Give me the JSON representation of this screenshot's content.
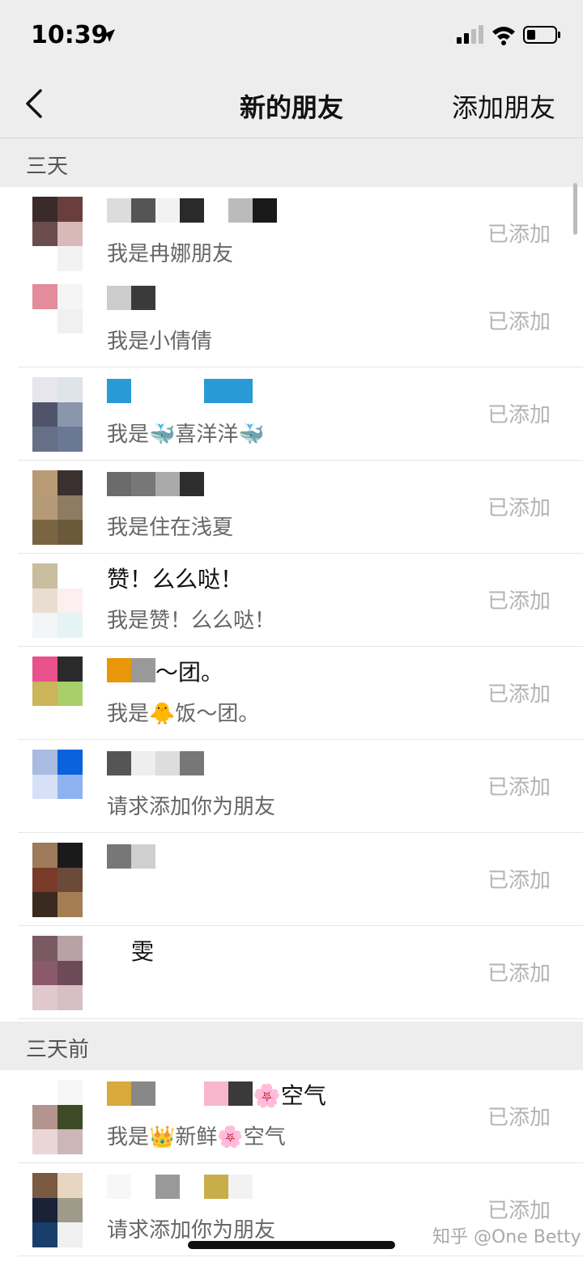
{
  "status_bar": {
    "time": "10:39"
  },
  "nav": {
    "title": "新的朋友",
    "add_friend": "添加朋友"
  },
  "sections": [
    {
      "label": "三天"
    },
    {
      "label": "三天前"
    }
  ],
  "rows": [
    {
      "name": "",
      "message": "我是冉娜朋友",
      "status": "已添加",
      "avatar_colors": [
        "#3a2a2a",
        "#6b3e3e",
        "#6b4d4d",
        "#d9b8b8",
        "#ffffff",
        "#f2f2f2"
      ],
      "name_mosaic": [
        "#dcdcdc",
        "#555555",
        "#f2f2f2",
        "#2a2a2a",
        "#ffffff",
        "#bbbbbb",
        "#1a1a1a"
      ]
    },
    {
      "name": "",
      "message": "我是小倩倩",
      "status": "已添加",
      "avatar_colors": [
        "#e38c9c",
        "#f5f5f5",
        "#ffffff",
        "#f0f0f0",
        "#ffffff",
        "#ffffff"
      ],
      "name_mosaic": [
        "#cccccc",
        "#3a3a3a"
      ]
    },
    {
      "name": "",
      "message": "我是🐳喜洋洋🐳",
      "status": "已添加",
      "avatar_colors": [
        "#e6e6ec",
        "#dfe4ea",
        "#50546a",
        "#8a96ab",
        "#657088",
        "#6b7894"
      ],
      "name_mosaic": [
        "#2a9ad6",
        "#ffffff",
        "#ffffff",
        "#ffffff",
        "#2a9ad6",
        "#2a9ad6"
      ]
    },
    {
      "name": "",
      "message": "我是住在浅夏",
      "status": "已添加",
      "avatar_colors": [
        "#b89a75",
        "#3a3030",
        "#b59a78",
        "#8f7b62",
        "#7a6542",
        "#6b5a3a"
      ],
      "name_mosaic": [
        "#6b6b6b",
        "#777777",
        "#aaaaaa",
        "#2d2d2d"
      ]
    },
    {
      "name": "赞！么么哒！",
      "message": "我是赞！么么哒！",
      "status": "已添加",
      "avatar_colors": [
        "#c9bd9f",
        "#ffffff",
        "#e8ddd0",
        "#fbeff0",
        "#f2f6f7",
        "#e6f3f5"
      ],
      "name_mosaic": []
    },
    {
      "name": "～团。",
      "message": "我是🐥饭～团。",
      "status": "已添加",
      "avatar_colors": [
        "#e9528c",
        "#2a2a2a",
        "#cbb45a",
        "#a8cf6a",
        "#ffffff",
        "#ffffff"
      ],
      "name_mosaic": [
        "#e8960a",
        "#999999"
      ]
    },
    {
      "name": "",
      "message": "请求添加你为朋友",
      "status": "已添加",
      "avatar_colors": [
        "#a9bbe0",
        "#0a62dc",
        "#d6e1f7",
        "#8fb2f0",
        "#ffffff",
        "#ffffff"
      ],
      "name_mosaic": [
        "#555555",
        "#eeeeee",
        "#dddddd",
        "#777777"
      ]
    },
    {
      "name": "",
      "message": "",
      "status": "已添加",
      "avatar_colors": [
        "#9c7a5a",
        "#1a1a1a",
        "#7a3a2a",
        "#6b4a3a",
        "#3a2a20",
        "#a57e55"
      ],
      "name_mosaic": [
        "#777777",
        "#cfcfcf",
        "#ffffff",
        "#ffffff"
      ]
    },
    {
      "name": "雯",
      "message": "",
      "status": "已添加",
      "avatar_colors": [
        "#7a5a62",
        "#b8a2a6",
        "#8a5a6a",
        "#6e4a58",
        "#e0c8cc",
        "#d8bfc4"
      ],
      "name_mosaic": [
        "#ffffff"
      ]
    },
    {
      "name": "🌸空气",
      "message": "我是👑新鲜🌸空气",
      "status": "已添加",
      "avatar_colors": [
        "#ffffff",
        "#f7f7f7",
        "#b3948e",
        "#3d4a26",
        "#ead6d6",
        "#cdb6b6"
      ],
      "name_mosaic": [
        "#d9a93a",
        "#888888",
        "#ffffff",
        "#ffffff",
        "#f7b6cb",
        "#3a3a3a"
      ]
    },
    {
      "name": "",
      "message": "请求添加你为朋友",
      "status": "已添加",
      "avatar_colors": [
        "#7a5a40",
        "#e6d6c2",
        "#1a2238",
        "#a09a8a",
        "#1a3e6a",
        "#f0f0f0"
      ],
      "name_mosaic": [
        "#f7f7f7",
        "#ffffff",
        "#999999",
        "#ffffff",
        "#c9ad4a",
        "#f2f2f2"
      ]
    }
  ],
  "watermark": "知乎 @One Betty"
}
